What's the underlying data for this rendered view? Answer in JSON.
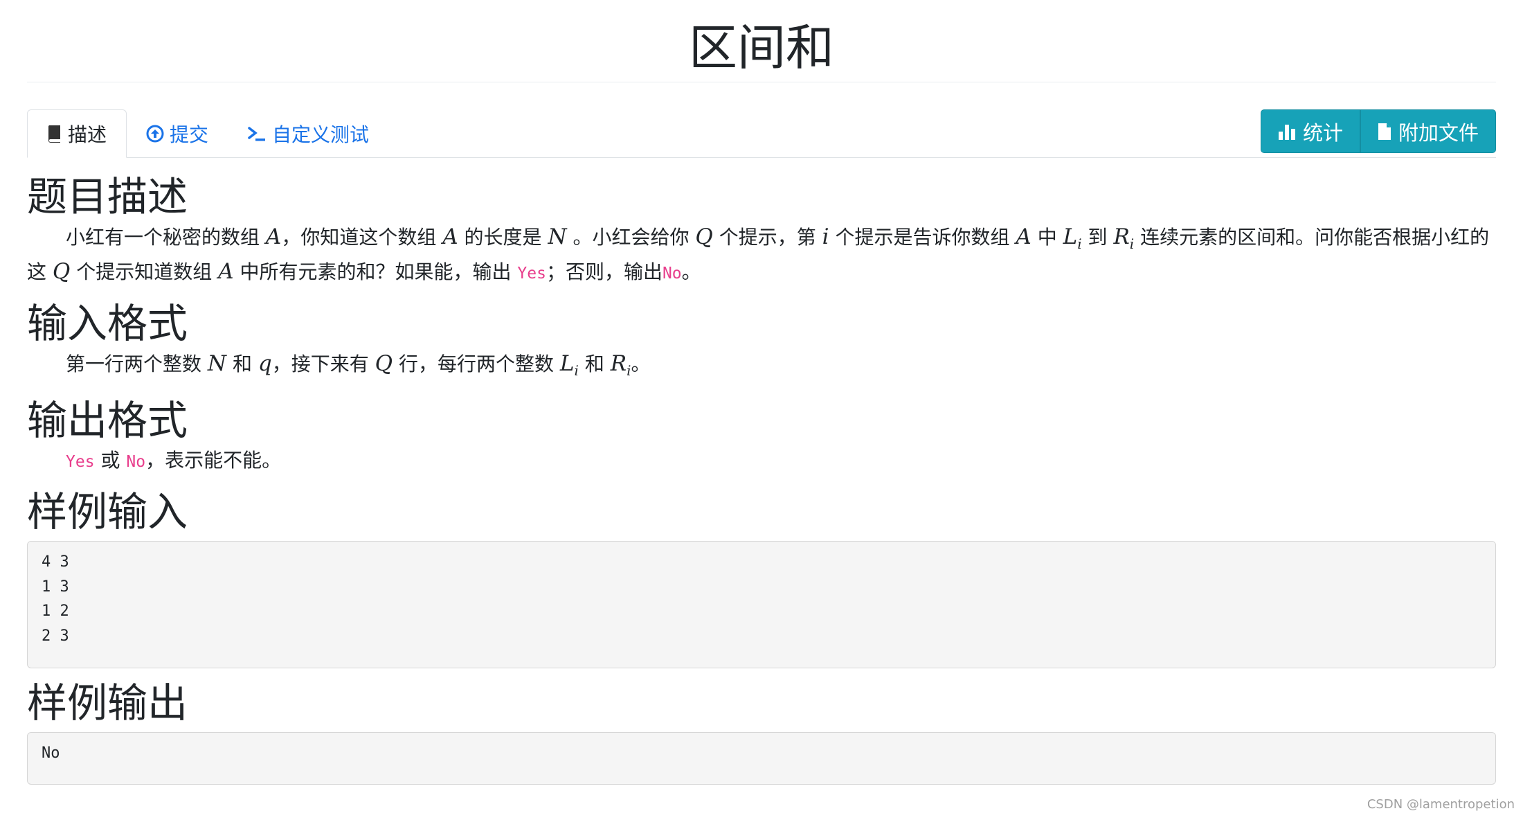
{
  "page_title": "区间和",
  "tabs": [
    {
      "label": "描述",
      "icon": "book-icon",
      "active": true
    },
    {
      "label": "提交",
      "icon": "upload-circle-icon",
      "active": false
    },
    {
      "label": "自定义测试",
      "icon": "terminal-icon",
      "active": false
    }
  ],
  "actions": {
    "stats_label": "统计",
    "attachments_label": "附加文件"
  },
  "description": {
    "heading": "题目描述",
    "p1": "小红有一个秘密的数组",
    "var_A": "A",
    "p2": "，你知道这个数组",
    "p3": "的长度是",
    "var_N": "N",
    "p4": "。小红会给你",
    "var_Q": "Q",
    "p5": "个提示，第",
    "var_i": "i",
    "p6": "个提示是告诉你数组",
    "p7": "中",
    "var_L": "L",
    "sub_i": "i",
    "p8": "到",
    "var_R": "R",
    "p9": "连续元素的区间和。问你能否根据小红的这",
    "p10": "个提示知道数组",
    "p11": "中所有元素的和？如果能，输出",
    "yes": "Yes",
    "p12": "；否则，输出",
    "no": "No",
    "p13": "。"
  },
  "input_format": {
    "heading": "输入格式",
    "t1": "第一行两个整数",
    "var_N": "N",
    "t2": "和",
    "var_q": "q",
    "t3": "，接下来有",
    "var_Q": "Q",
    "t4": "行，每行两个整数",
    "var_L": "L",
    "sub_i": "i",
    "t5": "和",
    "var_R": "R",
    "t6": "。"
  },
  "output_format": {
    "heading": "输出格式",
    "yes": "Yes",
    "t1": "或",
    "no": "No",
    "t2": "，表示能不能。"
  },
  "sample_input": {
    "heading": "样例输入",
    "content": "4 3\n1 3\n1 2\n2 3"
  },
  "sample_output": {
    "heading": "样例输出",
    "content": "No"
  },
  "watermark": "CSDN @lamentropetion",
  "colors": {
    "link": "#1a73e8",
    "info_button": "#17a2b8",
    "code_inline": "#e83e8c",
    "sample_bg": "#f5f5f5"
  }
}
